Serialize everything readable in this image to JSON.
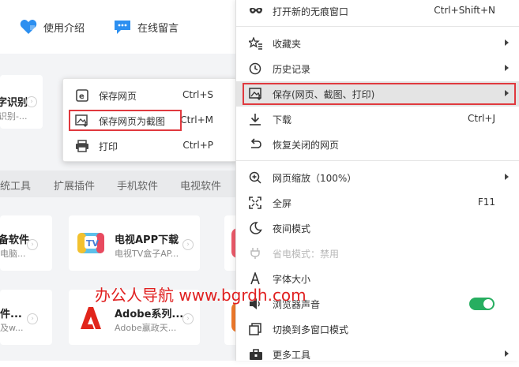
{
  "topbar": {
    "intro_label": "使用介绍",
    "message_label": "在线留言"
  },
  "cards": {
    "row1_left_title": "字识别",
    "row1_left_sub": "识别-...",
    "row2_left_title": "备软件",
    "row2_left_sub": "电脑...",
    "row2_right_title": "电视APP下载",
    "row2_right_sub": "电视TV盒子AP...",
    "row3_left_title": "件...",
    "row3_left_sub": "及w...",
    "row3_right_title": "Adobe系列...",
    "row3_right_sub": "Adobe嬴政天..."
  },
  "categories": [
    "统工具",
    "扩展插件",
    "手机软件",
    "电视软件"
  ],
  "submenu": {
    "items": [
      {
        "label": "保存网页",
        "shortcut": "Ctrl+S",
        "icon": "ie-page-icon"
      },
      {
        "label": "保存网页为截图",
        "shortcut": "Ctrl+M",
        "icon": "screenshot-save-icon"
      },
      {
        "label": "打印",
        "shortcut": "Ctrl+P",
        "icon": "printer-icon"
      }
    ]
  },
  "menu": {
    "incognito": {
      "label": "打开新的无痕窗口",
      "shortcut": "Ctrl+Shift+N"
    },
    "favorites": {
      "label": "收藏夹"
    },
    "history": {
      "label": "历史记录"
    },
    "save": {
      "label": "保存(网页、截图、打印)"
    },
    "downloads": {
      "label": "下载",
      "shortcut": "Ctrl+J"
    },
    "restore": {
      "label": "恢复关闭的网页"
    },
    "zoom": {
      "label": "网页缩放（100%）"
    },
    "fullscreen": {
      "label": "全屏",
      "shortcut": "F11"
    },
    "night": {
      "label": "夜间模式"
    },
    "power_saving": {
      "label": "省电模式：禁用"
    },
    "font_size": {
      "label": "字体大小"
    },
    "sound": {
      "label": "浏览器声音",
      "enabled": true
    },
    "multi_window": {
      "label": "切换到多窗口模式"
    },
    "more_tools": {
      "label": "更多工具"
    }
  },
  "watermark": "办公人导航 www.bgrdh.com",
  "colors": {
    "highlight_red": "#e0393e",
    "toggle_green": "#27ae60",
    "heart_blue": "#2c8ff0",
    "chat_blue": "#2c8ff0"
  }
}
